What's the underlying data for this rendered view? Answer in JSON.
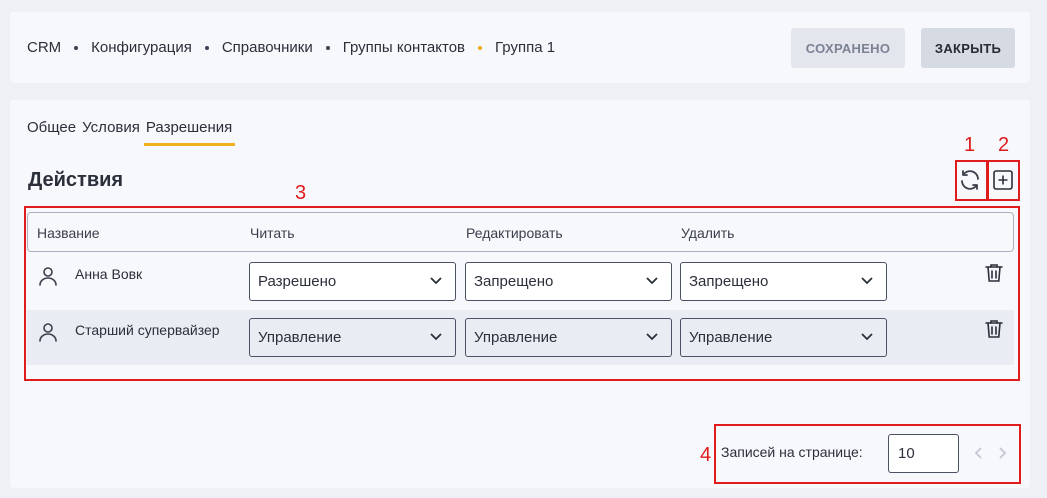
{
  "breadcrumb": [
    "CRM",
    "Конфигурация",
    "Справочники",
    "Группы контактов",
    "Группа 1"
  ],
  "header": {
    "saved_label": "СОХРАНЕНО",
    "close_label": "ЗАКРЫТЬ"
  },
  "tabs": [
    {
      "label": "Общее",
      "active": false
    },
    {
      "label": "Условия",
      "active": false
    },
    {
      "label": "Разрешения",
      "active": true
    }
  ],
  "section": {
    "title": "Действия"
  },
  "table": {
    "headers": [
      "Название",
      "Читать",
      "Редактировать",
      "Удалить"
    ],
    "rows": [
      {
        "name": "Анна Вовк",
        "read": "Разрешено",
        "edit": "Запрещено",
        "delete": "Запрещено"
      },
      {
        "name": "Старший супервайзер",
        "read": "Управление",
        "edit": "Управление",
        "delete": "Управление"
      }
    ]
  },
  "pagination": {
    "label": "Записей на странице:",
    "value": "10"
  },
  "annotations": [
    "1",
    "2",
    "3",
    "4"
  ],
  "icons": [
    "refresh-icon",
    "add-square-icon",
    "person-icon",
    "trash-icon",
    "chevron-down-icon",
    "chevron-left-icon",
    "chevron-right-icon"
  ],
  "colors": {
    "accent": "#f0b21a",
    "annotation_red": "#e01b1b"
  }
}
